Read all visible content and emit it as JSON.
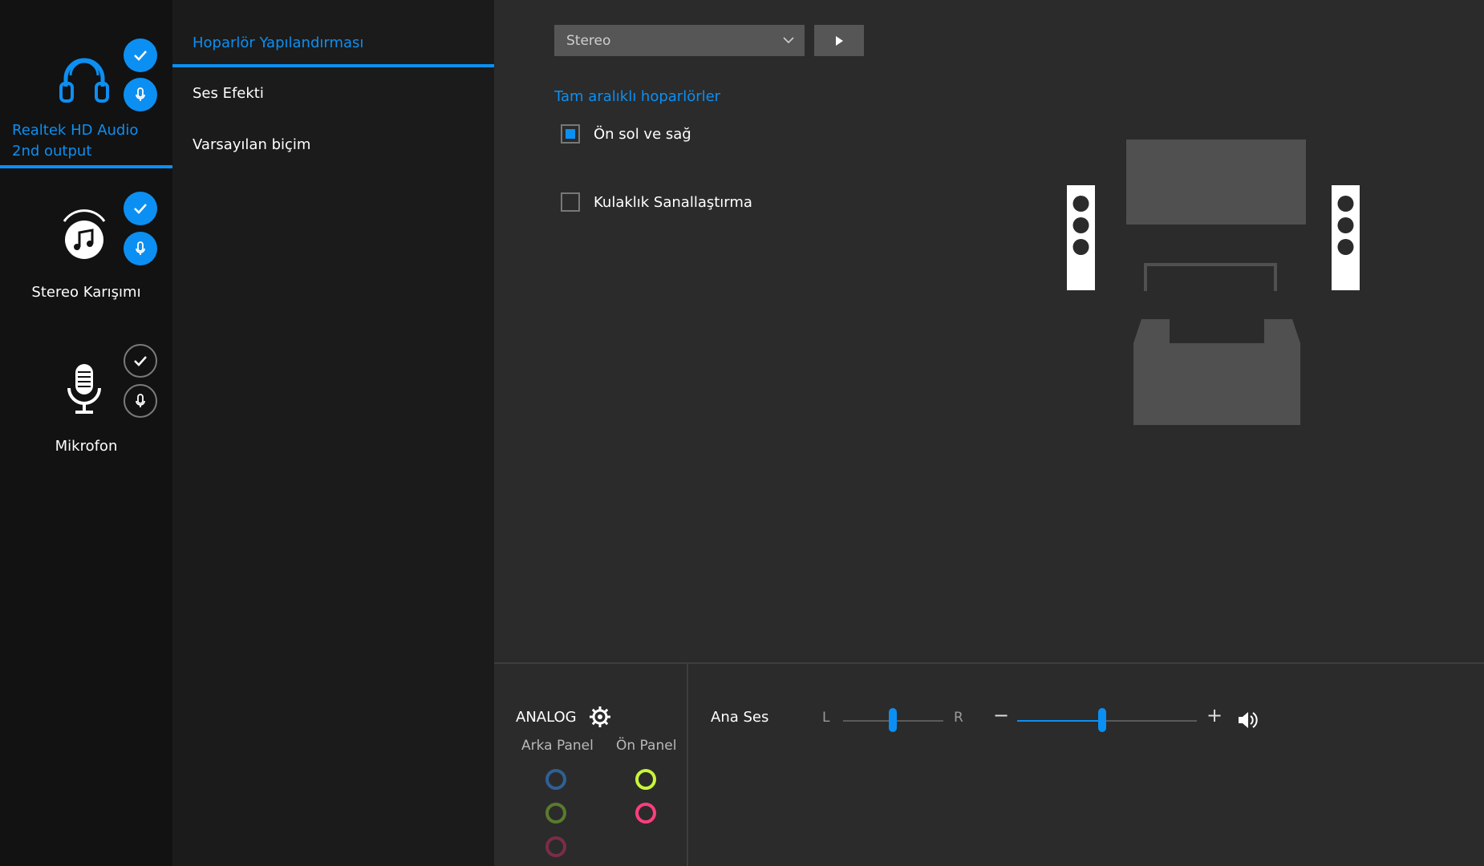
{
  "devices": [
    {
      "label": "Realtek HD Audio 2nd output",
      "icon": "headphones-icon",
      "active": true
    },
    {
      "label": "Stereo Karışımı",
      "icon": "music-note-icon",
      "active": false
    },
    {
      "label": "Mikrofon",
      "icon": "microphone-icon",
      "active": false
    }
  ],
  "tabs": [
    {
      "label": "Hoparlör Yapılandırması"
    },
    {
      "label": "Ses Efekti"
    },
    {
      "label": "Varsayılan biçim"
    }
  ],
  "config": {
    "selected": "Stereo",
    "section_title": "Tam aralıklı hoparlörler",
    "options": [
      {
        "label": "Ön sol ve sağ",
        "checked": true
      },
      {
        "label": "Kulaklık Sanallaştırma",
        "checked": false
      }
    ]
  },
  "analog": {
    "title": "ANALOG",
    "rear_panel": "Arka Panel",
    "front_panel": "Ön Panel",
    "rear_jacks": [
      "#2f5f96",
      "#5a7a2d",
      "#7a2d47"
    ],
    "front_jacks": [
      "#c8f53a",
      "#ff3d7f"
    ]
  },
  "master_volume": {
    "label": "Ana Ses",
    "balance_left": "L",
    "balance_right": "R",
    "balance": 0.5,
    "minus": "−",
    "plus": "+",
    "level": 0.47
  },
  "colors": {
    "accent": "#0c8ff2"
  }
}
